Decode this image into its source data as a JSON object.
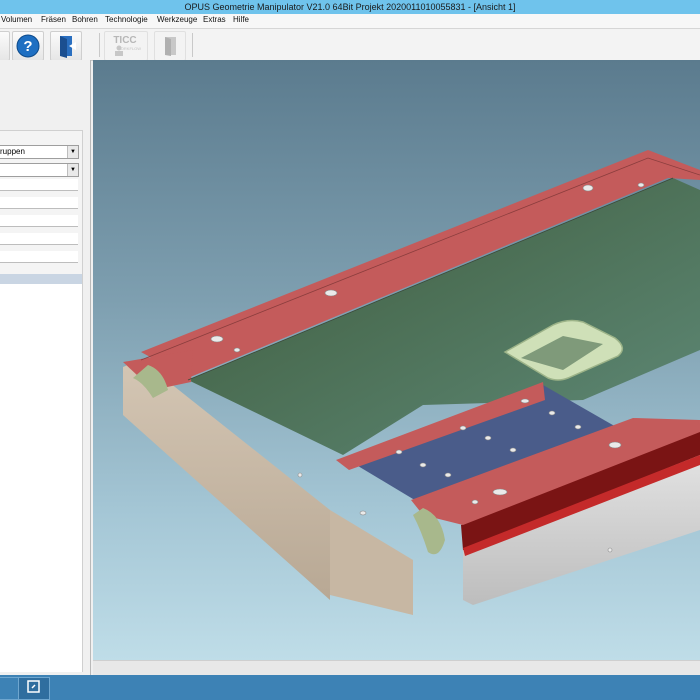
{
  "window": {
    "title": "OPUS Geometrie Manipulator V21.0 64Bit   Projekt 2020011010055831 - [Ansicht 1]"
  },
  "menu": {
    "items": [
      {
        "label": "Volumen"
      },
      {
        "label": "Fräsen"
      },
      {
        "label": "Bohren"
      },
      {
        "label": "Technologie"
      },
      {
        "label": "Werkzeuge"
      },
      {
        "label": "Extras"
      },
      {
        "label": "Hilfe"
      }
    ]
  },
  "toolbar": {
    "ticc_label": "TICC",
    "ticc_sub": "WORKFLOW",
    "buttons": [
      "help-icon",
      "exit-door-icon",
      "ticc-workflow-icon",
      "door-disabled-icon"
    ]
  },
  "left_panel": {
    "combo1_value": "ruppen",
    "combo2_value": ""
  },
  "viewport": {
    "background_top": "#5b7b8e",
    "background_bottom": "#bfdde8",
    "model_top_color": "#c45b5b",
    "model_side_color": "#c9b9a6",
    "pocket_color": "#4e6e4a"
  },
  "taskbar": {
    "color": "#3d82b5"
  }
}
